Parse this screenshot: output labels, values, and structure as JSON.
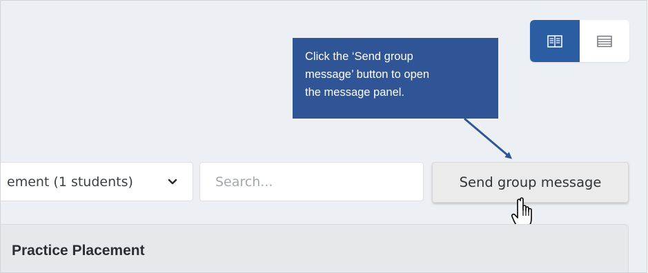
{
  "view_toggle": {
    "active_view": "card-view",
    "colors": {
      "active_bg": "#2b5da3",
      "inactive_bg": "#ffffff",
      "icon": "#6b6f75"
    }
  },
  "callout": {
    "text": "Click the ‘Send group\nmessage’ button to open\nthe message panel.",
    "colors": {
      "background": "#2f5597",
      "text": "#ffffff",
      "arrow": "#2f5597"
    }
  },
  "filters": {
    "group_select": {
      "selected": "ement (1 students)"
    },
    "search": {
      "placeholder": "Search...",
      "value": ""
    },
    "send_group_message_label": "Send group message"
  },
  "panel": {
    "title": "Practice Placement"
  },
  "colors": {
    "page_background": "#eceff3",
    "button_background": "#ebebeb"
  }
}
